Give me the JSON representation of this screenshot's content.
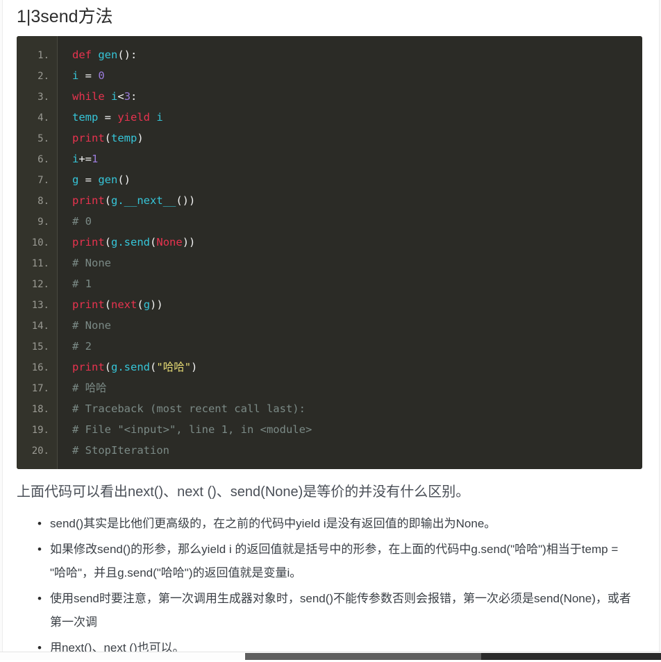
{
  "page": {
    "title": "1|3send方法",
    "background_color": "#ffffff"
  },
  "code_block": {
    "language": "python",
    "background_color": "#2b2b26",
    "gutter_color": "#33332b",
    "lines": [
      {
        "number": "1.",
        "tokens": [
          {
            "t": "def",
            "c": "kw"
          },
          {
            "t": " ",
            "c": "pun"
          },
          {
            "t": "gen",
            "c": "id"
          },
          {
            "t": "():",
            "c": "pun"
          }
        ]
      },
      {
        "number": "2.",
        "tokens": [
          {
            "t": "i",
            "c": "id"
          },
          {
            "t": " = ",
            "c": "pun"
          },
          {
            "t": "0",
            "c": "num"
          }
        ]
      },
      {
        "number": "3.",
        "tokens": [
          {
            "t": "while",
            "c": "kw"
          },
          {
            "t": " ",
            "c": "pun"
          },
          {
            "t": "i",
            "c": "id"
          },
          {
            "t": "<",
            "c": "pun"
          },
          {
            "t": "3",
            "c": "num"
          },
          {
            "t": ":",
            "c": "pun"
          }
        ]
      },
      {
        "number": "4.",
        "tokens": [
          {
            "t": "temp",
            "c": "id"
          },
          {
            "t": " = ",
            "c": "pun"
          },
          {
            "t": "yield",
            "c": "kw"
          },
          {
            "t": " ",
            "c": "pun"
          },
          {
            "t": "i",
            "c": "id"
          }
        ]
      },
      {
        "number": "5.",
        "tokens": [
          {
            "t": "print",
            "c": "fn"
          },
          {
            "t": "(",
            "c": "pun"
          },
          {
            "t": "temp",
            "c": "id"
          },
          {
            "t": ")",
            "c": "pun"
          }
        ]
      },
      {
        "number": "6.",
        "tokens": [
          {
            "t": "i",
            "c": "id"
          },
          {
            "t": "+=",
            "c": "pun"
          },
          {
            "t": "1",
            "c": "num"
          }
        ]
      },
      {
        "number": "7.",
        "tokens": [
          {
            "t": "g",
            "c": "id"
          },
          {
            "t": " = ",
            "c": "pun"
          },
          {
            "t": "gen",
            "c": "id"
          },
          {
            "t": "()",
            "c": "pun"
          }
        ]
      },
      {
        "number": "8.",
        "tokens": [
          {
            "t": "print",
            "c": "fn"
          },
          {
            "t": "(",
            "c": "pun"
          },
          {
            "t": "g.__next__",
            "c": "id"
          },
          {
            "t": "())",
            "c": "pun"
          }
        ]
      },
      {
        "number": "9.",
        "tokens": [
          {
            "t": "# 0",
            "c": "cmt"
          }
        ]
      },
      {
        "number": "10.",
        "tokens": [
          {
            "t": "print",
            "c": "fn"
          },
          {
            "t": "(",
            "c": "pun"
          },
          {
            "t": "g.send",
            "c": "id"
          },
          {
            "t": "(",
            "c": "pun"
          },
          {
            "t": "None",
            "c": "kw"
          },
          {
            "t": "))",
            "c": "pun"
          }
        ]
      },
      {
        "number": "11.",
        "tokens": [
          {
            "t": "# None",
            "c": "cmt"
          }
        ]
      },
      {
        "number": "12.",
        "tokens": [
          {
            "t": "# 1",
            "c": "cmt"
          }
        ]
      },
      {
        "number": "13.",
        "tokens": [
          {
            "t": "print",
            "c": "fn"
          },
          {
            "t": "(",
            "c": "pun"
          },
          {
            "t": "next",
            "c": "fn"
          },
          {
            "t": "(",
            "c": "pun"
          },
          {
            "t": "g",
            "c": "id"
          },
          {
            "t": "))",
            "c": "pun"
          }
        ]
      },
      {
        "number": "14.",
        "tokens": [
          {
            "t": "# None",
            "c": "cmt"
          }
        ]
      },
      {
        "number": "15.",
        "tokens": [
          {
            "t": "# 2",
            "c": "cmt"
          }
        ]
      },
      {
        "number": "16.",
        "tokens": [
          {
            "t": "print",
            "c": "fn"
          },
          {
            "t": "(",
            "c": "pun"
          },
          {
            "t": "g.send",
            "c": "id"
          },
          {
            "t": "(",
            "c": "pun"
          },
          {
            "t": "\"哈哈\"",
            "c": "str"
          },
          {
            "t": ")",
            "c": "pun"
          }
        ]
      },
      {
        "number": "17.",
        "tokens": [
          {
            "t": "# 哈哈",
            "c": "cmt"
          }
        ]
      },
      {
        "number": "18.",
        "tokens": [
          {
            "t": "# Traceback (most recent call last):",
            "c": "cmt"
          }
        ]
      },
      {
        "number": "19.",
        "tokens": [
          {
            "t": "# File \"<input>\", line 1, in <module>",
            "c": "cmt"
          }
        ]
      },
      {
        "number": "20.",
        "tokens": [
          {
            "t": "# StopIteration",
            "c": "cmt"
          }
        ]
      }
    ]
  },
  "prose": {
    "lead_paragraph": "上面代码可以看出next()、next ()、send(None)是等价的并没有什么区别。",
    "bullet_marker": "•",
    "notes": [
      "send()其实是比他们更高级的，在之前的代码中yield i是没有返回值的即输出为None。",
      "如果修改send()的形参，那么yield i 的返回值就是括号中的形参，在上面的代码中g.send(\"哈哈\")相当于temp = \"哈哈\"，并且g.send(\"哈哈\")的返回值就是变量i。",
      "使用send时要注意，第一次调用生成器对象时，send()不能传参数否则会报错，第一次必须是send(None)，或者第一次调",
      "用next()、next ()也可以。"
    ]
  },
  "scrollbar": {
    "orientation": "horizontal",
    "thumb_color": "#5f5f5f"
  }
}
